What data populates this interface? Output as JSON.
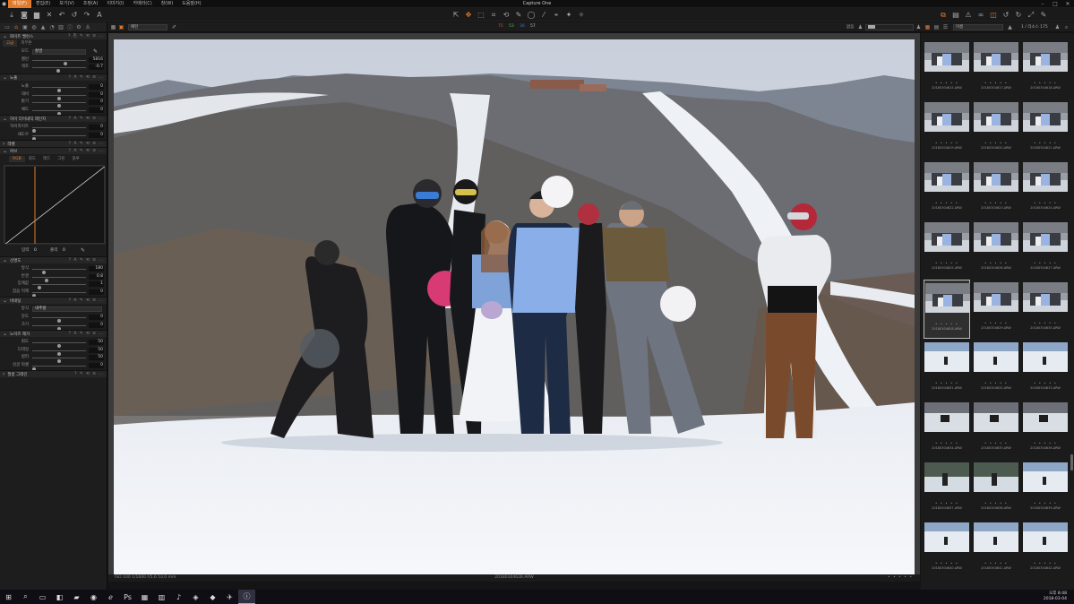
{
  "app": {
    "title": "Capture One",
    "menus": [
      "파일(F)",
      "편집(E)",
      "보기(V)",
      "조정(A)",
      "이미지(I)",
      "카메라(C)",
      "창(W)",
      "도움말(H)"
    ],
    "active_menu_index": 0
  },
  "toolbar": {
    "cursor_tools": [
      "⇱",
      "✥",
      "⬚",
      "⌗",
      "⟲",
      "✎",
      "◯",
      "⁄",
      "⌖",
      "✦",
      "✧"
    ],
    "right_tools": [
      "⧉",
      "▤",
      "⚠",
      "∞",
      "◫",
      "↺",
      "↻",
      "⤢",
      "✎"
    ]
  },
  "subtoolbar": {
    "view_select": "패턴",
    "rgb": {
      "r": "75",
      "g": "53",
      "b": "36",
      "l": "57"
    },
    "proof_label": "없음",
    "sort_select": "이름",
    "count_text": "1 / 리소스 175",
    "colors": {
      "r": "#d24a4a",
      "g": "#4ac04a",
      "b": "#4a6ad2",
      "l": "#bbbbbb"
    }
  },
  "left_panel": {
    "tabs": [
      "▭",
      "⌂",
      "▣",
      "◍",
      "▲",
      "◔",
      "▥",
      "ⓘ",
      "⚙",
      "⚓"
    ],
    "active_tab_index": 1,
    "white_balance": {
      "title": "화이트 밸런스",
      "subtabs": [
        "고급",
        "피부톤"
      ],
      "mode_label": "모드",
      "mode_value": "촬영",
      "kelvin_label": "켈빈",
      "kelvin_value": "5816",
      "kelvin_pos": 0.62,
      "tint_label": "색조",
      "tint_value": "-0.7",
      "tint_pos": 0.48
    },
    "exposure": {
      "title": "노출",
      "rows": [
        {
          "label": "노출",
          "value": "0",
          "pos": 0.5
        },
        {
          "label": "대비",
          "value": "0",
          "pos": 0.5
        },
        {
          "label": "밝기",
          "value": "0",
          "pos": 0.5
        },
        {
          "label": "채도",
          "value": "0",
          "pos": 0.5
        }
      ]
    },
    "hdr": {
      "title": "하이 다이내믹 레인지",
      "rows": [
        {
          "label": "하이라이트",
          "value": "0",
          "pos": 0.0
        },
        {
          "label": "섀도우",
          "value": "0",
          "pos": 0.0
        }
      ]
    },
    "levels": {
      "title": "레벨"
    },
    "curve": {
      "title": "커브",
      "subtabs": [
        "RGB",
        "휘도",
        "레드",
        "그린",
        "블루"
      ],
      "input_label": "입력",
      "input_value": "0",
      "output_label": "출력",
      "output_value": "0"
    },
    "clarity": {
      "title": "선명도",
      "rows": [
        {
          "label": "방식",
          "value": "180",
          "pos": 0.2
        },
        {
          "label": "반경",
          "value": "0.8",
          "pos": 0.25
        },
        {
          "label": "임계값",
          "value": "1",
          "pos": 0.1
        },
        {
          "label": "잡음 억제",
          "value": "0",
          "pos": 0.0
        }
      ]
    },
    "noise": {
      "title": "비네팅",
      "method_label": "방식",
      "method_value": "내추럴",
      "rows": [
        {
          "label": "강도",
          "value": "0",
          "pos": 0.5
        },
        {
          "label": "크기",
          "value": "0",
          "pos": 0.5
        }
      ]
    },
    "noise_reduction": {
      "title": "노이즈 제거",
      "rows": [
        {
          "label": "휘도",
          "value": "50",
          "pos": 0.5
        },
        {
          "label": "디테일",
          "value": "50",
          "pos": 0.5
        },
        {
          "label": "컬러",
          "value": "50",
          "pos": 0.5
        },
        {
          "label": "싱글 픽셀",
          "value": "0",
          "pos": 0.0
        }
      ]
    },
    "film_grain": {
      "title": "필름 그레인"
    }
  },
  "viewer": {
    "meta": "ISO 100  1/1600  f/5.6  53.0 mm",
    "filename": "20180304628.ARW",
    "stars": "• • • • •"
  },
  "browser": {
    "thumbs": [
      {
        "name": "20180304615.ARW",
        "kind": "group"
      },
      {
        "name": "20180304617.ARW",
        "kind": "group"
      },
      {
        "name": "20180304618.ARW",
        "kind": "group"
      },
      {
        "name": "20180304619.ARW",
        "kind": "group"
      },
      {
        "name": "20180304620.ARW",
        "kind": "group"
      },
      {
        "name": "20180304621.ARW",
        "kind": "group"
      },
      {
        "name": "20180304622.ARW",
        "kind": "group"
      },
      {
        "name": "20180304623.ARW",
        "kind": "group"
      },
      {
        "name": "20180304624.ARW",
        "kind": "group"
      },
      {
        "name": "20180304625.ARW",
        "kind": "group"
      },
      {
        "name": "20180304626.ARW",
        "kind": "group"
      },
      {
        "name": "20180304627.ARW",
        "kind": "group"
      },
      {
        "name": "20180304628.ARW",
        "kind": "group"
      },
      {
        "name": "20180304629.ARW",
        "kind": "group"
      },
      {
        "name": "20180304630.ARW",
        "kind": "group"
      },
      {
        "name": "20180304631.ARW",
        "kind": "snow"
      },
      {
        "name": "20180304632.ARW",
        "kind": "snow"
      },
      {
        "name": "20180304633.ARW",
        "kind": "snow"
      },
      {
        "name": "20180304634.ARW",
        "kind": "snowdark"
      },
      {
        "name": "20180304635.ARW",
        "kind": "snowdark"
      },
      {
        "name": "20180304636.ARW",
        "kind": "snowdark"
      },
      {
        "name": "20180304637.ARW",
        "kind": "snowtree"
      },
      {
        "name": "20180304638.ARW",
        "kind": "snowtree"
      },
      {
        "name": "20180304639.ARW",
        "kind": "snow"
      },
      {
        "name": "20180304640.ARW",
        "kind": "snow"
      },
      {
        "name": "20180304641.ARW",
        "kind": "snow"
      },
      {
        "name": "20180304642.ARW",
        "kind": "snow"
      }
    ],
    "selected_index": 12,
    "stars": "• • • • •"
  },
  "taskbar": {
    "apps": [
      "⊞",
      "⌕",
      "▭",
      "◧",
      "▰",
      "◉",
      "ℯ",
      "Ps",
      "▦",
      "▥",
      "♪",
      "◈",
      "◆",
      "✈",
      "ⓘ"
    ],
    "active_index": 14,
    "time": "오후 8:48",
    "date": "2018-03-04"
  }
}
